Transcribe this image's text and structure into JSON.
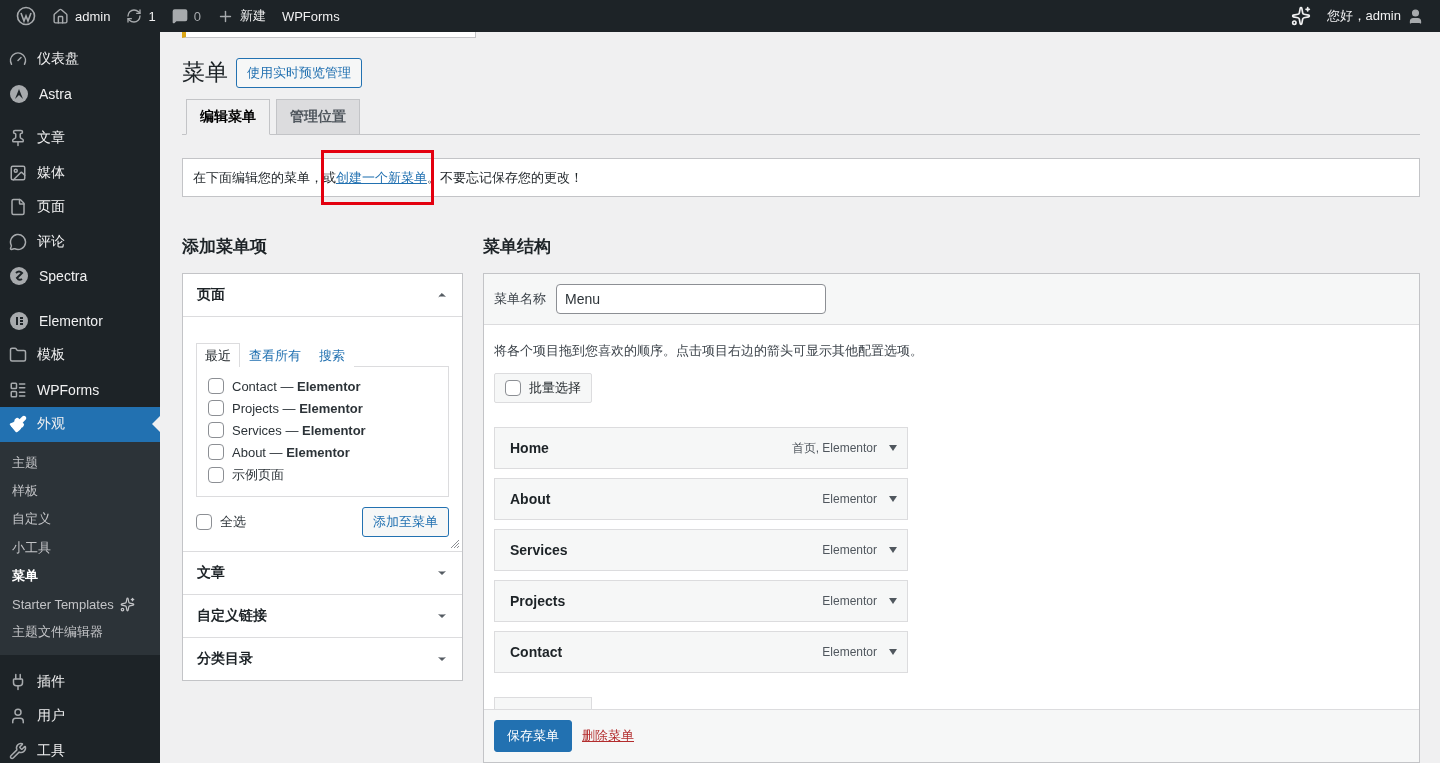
{
  "admin_bar": {
    "site": "admin",
    "updates": "1",
    "comments": "0",
    "new": "新建",
    "plugin": "WPForms",
    "greeting": "您好，admin"
  },
  "sidebar": {
    "groups": [
      [
        {
          "label": "仪表盘",
          "selected": false
        },
        {
          "label": "Astra",
          "selected": false
        }
      ],
      [
        {
          "label": "文章",
          "selected": false
        },
        {
          "label": "媒体",
          "selected": false
        },
        {
          "label": "页面",
          "selected": false
        },
        {
          "label": "评论",
          "selected": false
        },
        {
          "label": "Spectra",
          "selected": false
        }
      ],
      [
        {
          "label": "Elementor",
          "selected": false
        },
        {
          "label": "模板",
          "selected": false
        },
        {
          "label": "WPForms",
          "selected": false
        },
        {
          "label": "外观",
          "selected": true,
          "children": [
            {
              "label": "主题",
              "selected": false
            },
            {
              "label": "样板",
              "selected": false
            },
            {
              "label": "自定义",
              "selected": false
            },
            {
              "label": "小工具",
              "selected": false
            },
            {
              "label": "菜单",
              "selected": true
            },
            {
              "label": "Starter Templates",
              "selected": false
            },
            {
              "label": "主题文件编辑器",
              "selected": false
            }
          ]
        }
      ],
      [
        {
          "label": "插件",
          "selected": false
        },
        {
          "label": "用户",
          "selected": false
        },
        {
          "label": "工具",
          "selected": false
        }
      ]
    ]
  },
  "page": {
    "title": "菜单",
    "title_button": "使用实时预览管理",
    "tabs": [
      {
        "label": "编辑菜单",
        "selected": true
      },
      {
        "label": "管理位置",
        "selected": false
      }
    ],
    "notice": {
      "before": "在下面编辑您的菜单，或",
      "link": "创建一个新菜单",
      "after": "。不要忘记保存您的更改！"
    }
  },
  "add_items": {
    "title": "添加菜单项",
    "sections": [
      {
        "label": "页面",
        "expanded": true,
        "tabs": [
          {
            "label": "最近",
            "selected": true
          },
          {
            "label": "查看所有",
            "selected": false
          },
          {
            "label": "搜索",
            "selected": false
          }
        ],
        "items": [
          {
            "label": "Contact — **Elementor**",
            "checked": false
          },
          {
            "label": "Projects — **Elementor**",
            "checked": false
          },
          {
            "label": "Services — **Elementor**",
            "checked": false
          },
          {
            "label": "About — **Elementor**",
            "checked": false
          },
          {
            "label": "示例页面",
            "checked": false
          }
        ],
        "select_all": {
          "label": "全选",
          "checked": false
        },
        "add_button": "添加至菜单"
      },
      {
        "label": "文章",
        "expanded": false
      },
      {
        "label": "自定义链接",
        "expanded": false
      },
      {
        "label": "分类目录",
        "expanded": false
      }
    ]
  },
  "structure": {
    "title": "菜单结构",
    "name_label": "菜单名称",
    "name_value": "Menu",
    "hint": "将各个项目拖到您喜欢的顺序。点击项目右边的箭头可显示其他配置选项。",
    "bulk_select": {
      "label": "批量选择",
      "checked": false
    },
    "items": [
      {
        "label": "Home",
        "note": "首页, Elementor"
      },
      {
        "label": "About",
        "note": "Elementor"
      },
      {
        "label": "Services",
        "note": "Elementor"
      },
      {
        "label": "Projects",
        "note": "Elementor"
      },
      {
        "label": "Contact",
        "note": "Elementor"
      }
    ],
    "save": "保存菜单",
    "delete": "删除菜单"
  }
}
